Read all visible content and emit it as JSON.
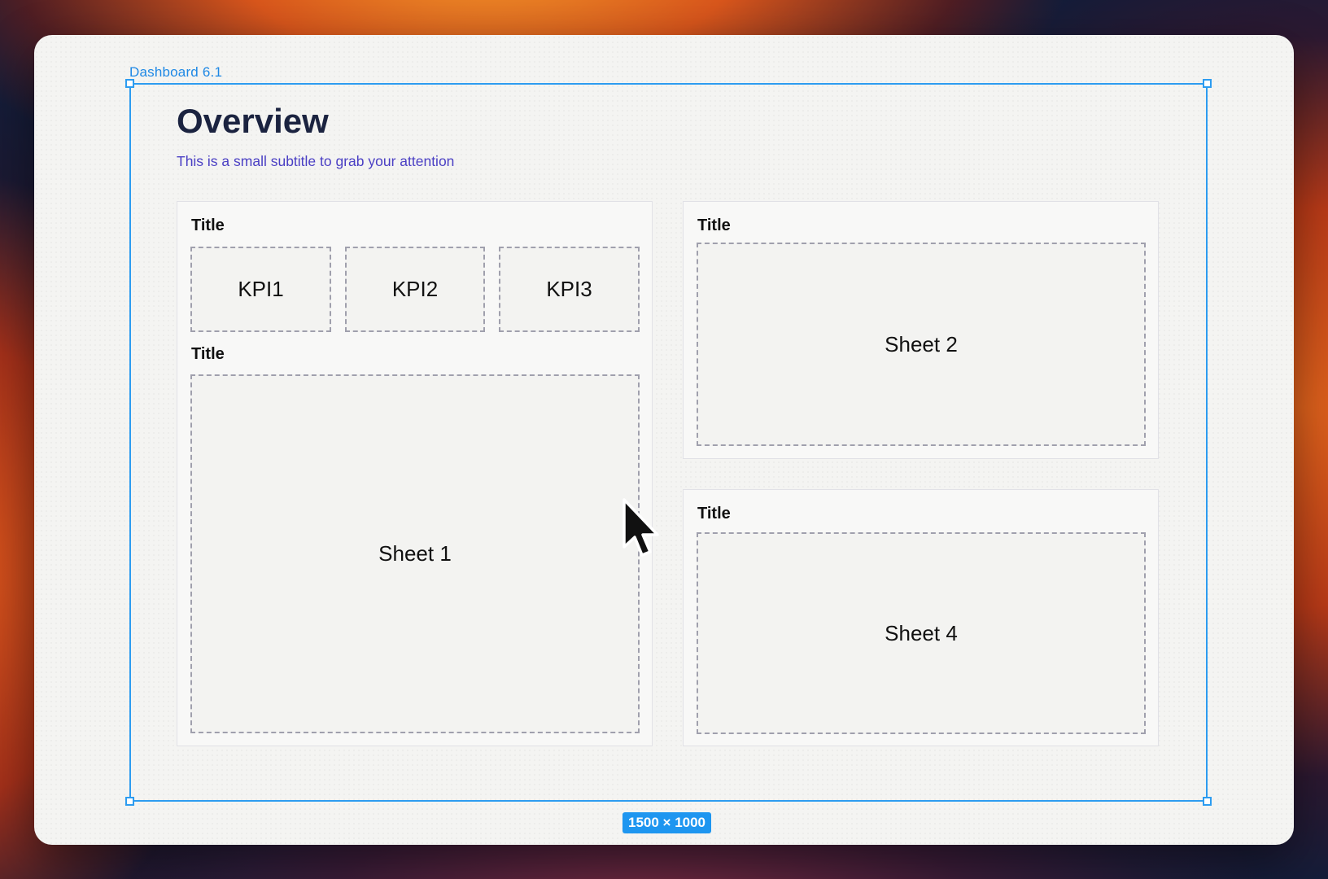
{
  "frame": {
    "label": "Dashboard 6.1",
    "size_badge": "1500 × 1000"
  },
  "header": {
    "title": "Overview",
    "subtitle": "This is a small subtitle to grab your attention"
  },
  "left_card": {
    "kpi_title": "Title",
    "kpis": [
      "KPI1",
      "KPI2",
      "KPI3"
    ],
    "sheet_title": "Title",
    "sheet_label": "Sheet 1"
  },
  "right_top_card": {
    "title": "Title",
    "sheet_label": "Sheet 2"
  },
  "right_bottom_card": {
    "title": "Title",
    "sheet_label": "Sheet 4"
  },
  "colors": {
    "selection": "#2d9cf0",
    "title": "#1b2340",
    "subtitle": "#4a3fc4"
  }
}
